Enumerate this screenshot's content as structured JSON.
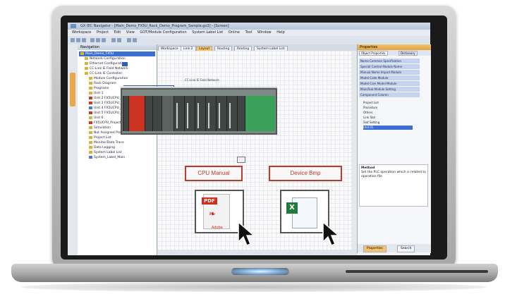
{
  "window": {
    "title": "GX IEC Navigator - [Main_Demo_FX5U_Rack_Demo_Program_Sample.gx3] - [Screen]"
  },
  "menu": [
    "Workspace",
    "Project",
    "Edit",
    "View",
    "GOT/Module Configuration",
    "System Label List",
    "Online",
    "Tool",
    "Window",
    "Help"
  ],
  "left_rail": {
    "tab_label": "Navigation"
  },
  "navigation": {
    "header": "Navigation",
    "tree": [
      {
        "label": "Main_Demo_FX5U",
        "selected": true,
        "icon": "project"
      },
      {
        "label": "Network Configuration",
        "selected": false,
        "icon": "folder"
      },
      {
        "label": "Ethernet Configuration",
        "selected": false,
        "icon": "folder"
      },
      {
        "label": "CC-Link IE Field Network",
        "selected": false,
        "icon": "folder"
      },
      {
        "label": "CC-Link IE Controller",
        "selected": false,
        "icon": "folder"
      },
      {
        "label": "Module Configuration",
        "selected": false,
        "icon": "folder"
      },
      {
        "label": "Rack Diagram",
        "selected": false,
        "icon": "folder"
      },
      {
        "label": "Programs",
        "selected": false,
        "icon": "folder"
      },
      {
        "label": "Unit 1",
        "selected": false,
        "icon": "folder"
      },
      {
        "label": "Unit 2 FX5UCPU_Project",
        "selected": false,
        "icon": "red"
      },
      {
        "label": "Unit 3 FX5UCPU_Project",
        "selected": false,
        "icon": "red"
      },
      {
        "label": "Unit 4 FX5UCPU_Project",
        "selected": false,
        "icon": "blue"
      },
      {
        "label": "Unit 5 FX5UCPU_Project",
        "selected": false,
        "icon": "red"
      },
      {
        "label": "Unit 6",
        "selected": false,
        "icon": "folder"
      },
      {
        "label": "FX5UCPU_Project(GX Works3)",
        "selected": false,
        "icon": "red"
      },
      {
        "label": "Simulation",
        "selected": false,
        "icon": "folder"
      },
      {
        "label": "Not Assigned Project",
        "selected": false,
        "icon": "folder"
      },
      {
        "label": "Project List",
        "selected": false,
        "icon": "folder"
      },
      {
        "label": "Monitor/Data Trace",
        "selected": false,
        "icon": "folder"
      },
      {
        "label": "Data Logging",
        "selected": false,
        "icon": "folder"
      },
      {
        "label": "System Label List",
        "selected": false,
        "icon": "folder"
      },
      {
        "label": "System_Label_Main",
        "selected": false,
        "icon": "blue"
      }
    ]
  },
  "editor_tabs": [
    {
      "label": "Workspace",
      "active": false
    },
    {
      "label": "Link 2",
      "active": false
    },
    {
      "label": "Layout",
      "active": true
    },
    {
      "label": "Routing",
      "active": false
    },
    {
      "label": "Routing",
      "active": false
    },
    {
      "label": "System Label List",
      "active": false
    }
  ],
  "canvas": {
    "network_label": "CC-Link IE Field Network",
    "manual_button": "CPU Manual",
    "bom_button": "Device Bmp",
    "pdf_badge": "PDF",
    "pdf_caption": "Adobe",
    "excel_badge": "X"
  },
  "properties": {
    "header": "Properties",
    "tabs": [
      "Object Properties",
      "Dictionary"
    ],
    "categories": [
      "Name Common Specification",
      "Special Control Module Name",
      "Manual Name Import Module",
      "Model Code Module",
      "Model Com Model Module",
      "Main/Sub Module Setting",
      "Component Column"
    ],
    "items": [
      {
        "label": "Project List",
        "selected": false
      },
      {
        "label": "Procedure",
        "selected": false
      },
      {
        "label": "Others",
        "selected": false
      },
      {
        "label": "Link Slot",
        "selected": false
      },
      {
        "label": "Slot Setting",
        "selected": false
      },
      {
        "label": "Unit 01",
        "selected": true
      }
    ],
    "description_title": "Method",
    "description_text": "Set the PLC operation which is related to operation file",
    "footer_tabs": [
      "Properties",
      "Search"
    ]
  },
  "colors": {
    "accent": "#3a6fd0",
    "module_red": "#cc3322",
    "module_green": "#3aa05a",
    "manual_red": "#c0392b"
  }
}
